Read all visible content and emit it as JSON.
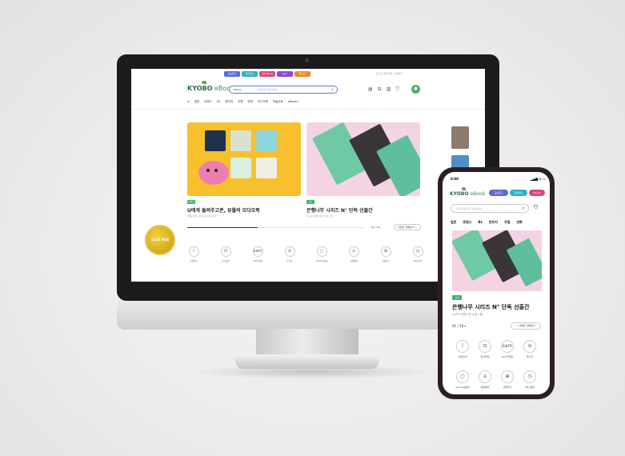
{
  "desktop": {
    "util_tabs": [
      {
        "label": "교보문고",
        "color": "#5b6bd5"
      },
      {
        "label": "핫트랙스",
        "color": "#2db0c9"
      },
      {
        "label": "교보eBook",
        "color": "#e0457b"
      },
      {
        "label": "sam",
        "color": "#8a4bd6"
      },
      {
        "label": "톡소다",
        "color": "#f08a24"
      }
    ],
    "util_links": "로그인 회원가입 고객센터",
    "logo_main": "KYOBO",
    "logo_sub": " eBook",
    "search": {
      "select": "eBook",
      "placeholder": "검색어를 입력하세요"
    },
    "gnb": [
      "≡",
      "일반",
      "로맨스",
      "BL",
      "판타지",
      "무협",
      "만화",
      "오디오북",
      "학술논문",
      "eBook+"
    ],
    "banners": [
      {
        "tag": "이벤트",
        "title": "U에게 들려주고픈, 유월의 오디오북",
        "subtitle": "작품 감상 오디오북 무료 추천"
      },
      {
        "tag": "신간",
        "title": "은행나무 시리즈 N° 단독 선출간",
        "subtitle": "누구의 정체 n번 소설 1월"
      }
    ],
    "pager": "01 / 10",
    "all_button": "이벤트 전체보기 >",
    "services": [
      {
        "icon": "i",
        "label": "이용안내"
      },
      {
        "icon": "⊡",
        "label": "독서플랜"
      },
      {
        "icon": "sam",
        "label": "sam무제한"
      },
      {
        "icon": "≋",
        "label": "투시지"
      },
      {
        "icon": "▢",
        "label": "ebook상품권"
      },
      {
        "icon": "♙",
        "label": "회원혜택"
      },
      {
        "icon": "⊞",
        "label": "선물하기"
      },
      {
        "icon": "◷",
        "label": "e캐시충전"
      }
    ],
    "badge_text": "2023 WIN"
  },
  "mobile": {
    "time": "6:08",
    "status": "▂▄▆ ≋ ▭",
    "logo_main": "KYOBO",
    "logo_sub": " eBook",
    "tabs": [
      {
        "label": "교보문고",
        "color": "#5b6bd5"
      },
      {
        "label": "핫트랙스",
        "color": "#2db0c9"
      },
      {
        "label": "eBook",
        "color": "#e0457b"
      }
    ],
    "search_placeholder": "검색 키워드를 입력하세요",
    "gnb": [
      "일반",
      "로맨스",
      "BL",
      "판타지",
      "무협",
      "만화"
    ],
    "tag": "신간",
    "title": "은행나무 시리즈 N° 단독 선출간",
    "subtitle": "누구의 정체 n번 소설 1월",
    "pager": "01 / 10 ⏸",
    "all_button": "< 이벤트 전체보기",
    "services": [
      {
        "icon": "i",
        "label": "이용안내"
      },
      {
        "icon": "⊡",
        "label": "독서플랜"
      },
      {
        "icon": "sam",
        "label": "sam무제한"
      },
      {
        "icon": "≋",
        "label": "투시지"
      },
      {
        "icon": "▢",
        "label": "ebook상품권"
      },
      {
        "icon": "♙",
        "label": "회원혜택"
      },
      {
        "icon": "⊞",
        "label": "선물하기"
      },
      {
        "icon": "◷",
        "label": "e캐시충전"
      }
    ]
  }
}
